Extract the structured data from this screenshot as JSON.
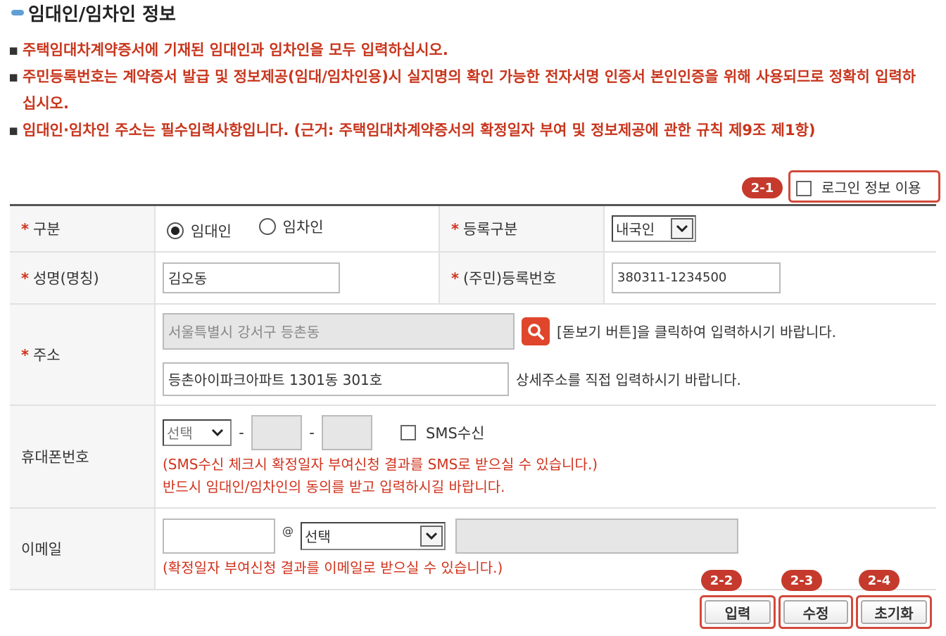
{
  "section": {
    "title": "임대인/임차인 정보"
  },
  "notices": [
    "주택임대차계약증서에 기재된 임대인과 임차인을 모두 입력하십시오.",
    "주민등록번호는 계약증서 발급 및 정보제공(임대/임차인용)시 실지명의 확인 가능한 전자서명 인증서 본인인증을 위해 사용되므로 정확히 입력하십시오.",
    "임대인·임차인 주소는 필수입력사항입니다. (근거: 주택임대차계약증서의 확정일자 부여 및 정보제공에 관한 규칙 제9조 제1항)"
  ],
  "badges": {
    "b21": "2-1",
    "b22": "2-2",
    "b23": "2-3",
    "b24": "2-4"
  },
  "login_info": {
    "label": "로그인 정보 이용",
    "checked": false
  },
  "form": {
    "type_label": "구분",
    "type_options": [
      "임대인",
      "임차인"
    ],
    "type_selected": "임대인",
    "reg_type_label": "등록구분",
    "reg_type_value": "내국인",
    "name_label": "성명(명칭)",
    "name_value": "김오동",
    "regno_label": "(주민)등록번호",
    "regno_value": "380311-1234500",
    "address_label": "주소",
    "address_value": "서울특별시 강서구 등촌동",
    "address_hint": "[돋보기 버튼]을 클릭하여 입력하시기 바랍니다.",
    "address_detail_value": "등촌아이파크아파트 1301동 301호",
    "address_detail_hint": "상세주소를 직접 입력하시기 바랍니다.",
    "phone_label": "휴대폰번호",
    "phone_prefix": "선택",
    "phone_sep": "-",
    "sms_label": "SMS수신",
    "phone_note1": "(SMS수신 체크시 확정일자 부여신청 결과를 SMS로 받으실 수 있습니다.)",
    "phone_note2": "반드시 임대인/임차인의 동의를 받고 입력하시길 바랍니다.",
    "email_label": "이메일",
    "email_at": "@",
    "email_domain": "선택",
    "email_note": "(확정일자 부여신청 결과를 이메일로 받으실 수 있습니다.)"
  },
  "buttons": {
    "submit": "입력",
    "edit": "수정",
    "reset": "초기화"
  },
  "colors": {
    "accent_red": "#c53a2c",
    "notice_red": "#c8351c",
    "title_pill": "#5f9fd6"
  }
}
